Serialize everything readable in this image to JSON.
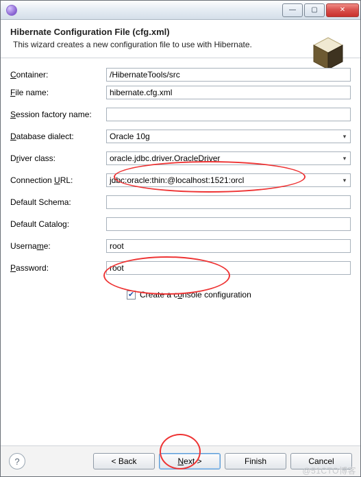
{
  "titlebar": {
    "min": "—",
    "max": "▢",
    "close": "✕"
  },
  "header": {
    "title": "Hibernate Configuration File (cfg.xml)",
    "subtitle": "This wizard creates a new configuration file to use with Hibernate."
  },
  "labels": {
    "container": "Container:",
    "filename": "File name:",
    "sessionFactory": "Session factory name:",
    "dialect": "Database dialect:",
    "driver": "Driver class:",
    "url": "Connection URL:",
    "schema": "Default Schema:",
    "catalog": "Default Catalog:",
    "username": "Username:",
    "password": "Password:",
    "console": "Create a console configuration"
  },
  "mnemonics": {
    "container": "C",
    "filename": "F",
    "sessionFactory": "S",
    "dialect": "D",
    "driver": "r",
    "url": "U",
    "username": "m",
    "password": "P",
    "console": "o"
  },
  "values": {
    "container": "/HibernateTools/src",
    "filename": "hibernate.cfg.xml",
    "sessionFactory": "",
    "dialect": "Oracle 10g",
    "driver": "oracle.jdbc.driver.OracleDriver",
    "url": "jdbc:oracle:thin:@localhost:1521:orcl",
    "schema": "",
    "catalog": "",
    "username": "root",
    "password": "root"
  },
  "buttons": {
    "back": "< Back",
    "next": "Next >",
    "finish": "Finish",
    "cancel": "Cancel"
  },
  "watermark": "@51CTO博客"
}
